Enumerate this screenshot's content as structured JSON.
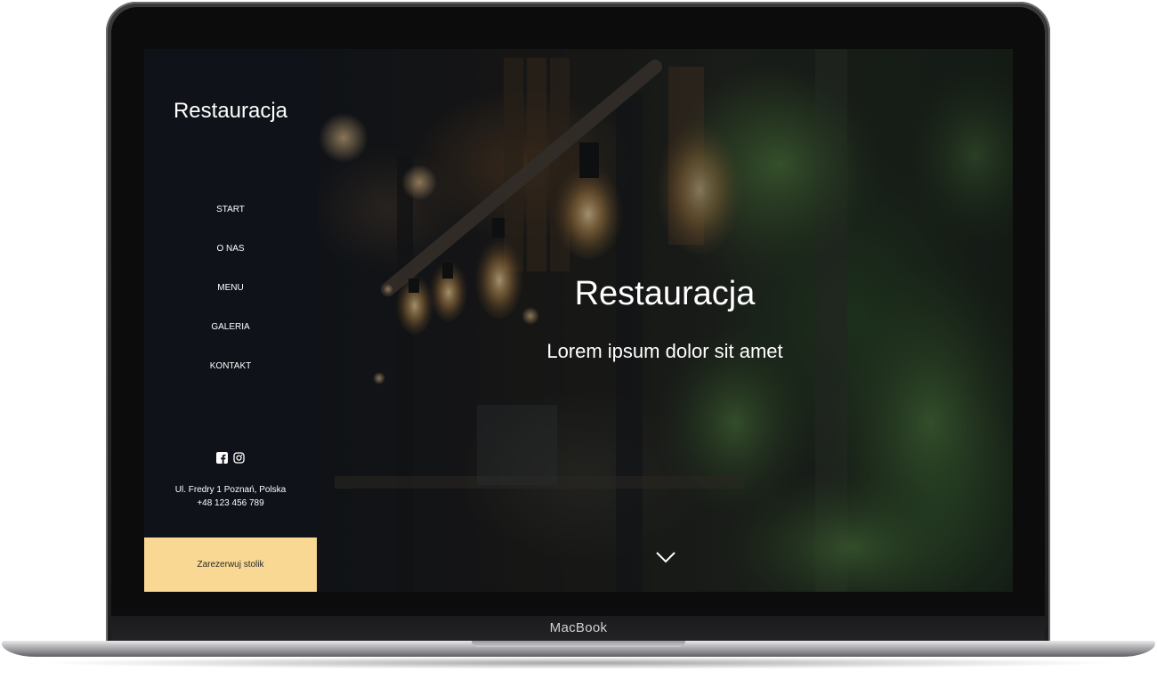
{
  "device": {
    "brand_label": "MacBook"
  },
  "sidebar": {
    "logo": "Restauracja",
    "nav": [
      {
        "label": "START"
      },
      {
        "label": "O NAS"
      },
      {
        "label": "MENU"
      },
      {
        "label": "GALERIA"
      },
      {
        "label": "KONTAKT"
      }
    ],
    "social_icons": [
      "facebook-icon",
      "instagram-icon"
    ],
    "address_line": "Ul. Fredry 1 Poznań, Polska",
    "phone": "+48 123 456 789",
    "reserve_button": "Zarezerwuj stolik"
  },
  "hero": {
    "title": "Restauracja",
    "subtitle": "Lorem ipsum dolor sit amet",
    "scroll_icon": "chevron-down-icon",
    "background_image": "dim restaurant interior with hanging Edison light bulbs and green plants"
  },
  "colors": {
    "sidebar_bg": "#0f1219",
    "reserve_bg": "#f8d892",
    "text": "#ffffff"
  }
}
